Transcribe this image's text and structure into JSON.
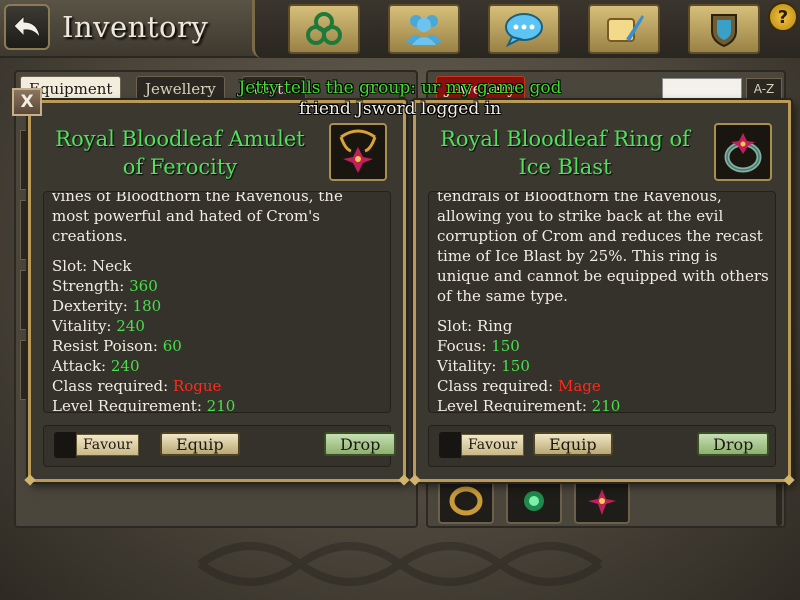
{
  "header": {
    "title": "Inventory",
    "help_label": "?"
  },
  "tabs": {
    "left": [
      "Equipment",
      "Jewellery",
      "Vast..."
    ],
    "right_active": "Jewellery",
    "sort_label": "A-Z"
  },
  "chat": {
    "line1": "Jetty tells the group: ur my game god",
    "line2": "friend Jsword logged in"
  },
  "popup_left": {
    "name_line1": "Royal Bloodleaf Amulet",
    "name_line2": "of Ferocity",
    "icon": "amulet-icon",
    "description": "vines of Bloodthorn the Ravenous, the most powerful and hated of Crom's creations.",
    "stats": [
      {
        "label": "Slot: Neck",
        "value": ""
      },
      {
        "label": "Strength: ",
        "value": "360"
      },
      {
        "label": "Dexterity: ",
        "value": "180"
      },
      {
        "label": "Vitality: ",
        "value": "240"
      },
      {
        "label": "Resist Poison: ",
        "value": "60"
      },
      {
        "label": "Attack: ",
        "value": "240"
      },
      {
        "label": "Class required: ",
        "value": "Rogue"
      },
      {
        "label": "Level Requirement:  ",
        "value": "210"
      }
    ],
    "favour_label": "Favour",
    "equip_label": "Equip",
    "drop_label": "Drop"
  },
  "popup_right": {
    "name_line1": "Royal Bloodleaf Ring of",
    "name_line2": "Ice Blast",
    "icon": "ring-icon",
    "description": "tendrals of Bloodthorn the Ravenous, allowing you to strike back at the evil corruption of Crom and reduces the recast time of Ice Blast by 25%. This ring is unique and cannot be equipped with others of the same type.",
    "stats": [
      {
        "label": "Slot: Ring",
        "value": ""
      },
      {
        "label": "Focus: ",
        "value": "150"
      },
      {
        "label": "Vitality: ",
        "value": "150"
      },
      {
        "label": "Class required: ",
        "value": "Mage"
      },
      {
        "label": "Level Requirement:  ",
        "value": "210"
      }
    ],
    "favour_label": "Favour",
    "equip_label": "Equip",
    "drop_label": "Drop"
  },
  "close_label": "X",
  "colors": {
    "item_name": "#4fe25a",
    "stat_value": "#45e04a",
    "class_value": "#ff2a1c",
    "chat_group": "#3fdc2f",
    "popup_border": "#b99a58"
  }
}
